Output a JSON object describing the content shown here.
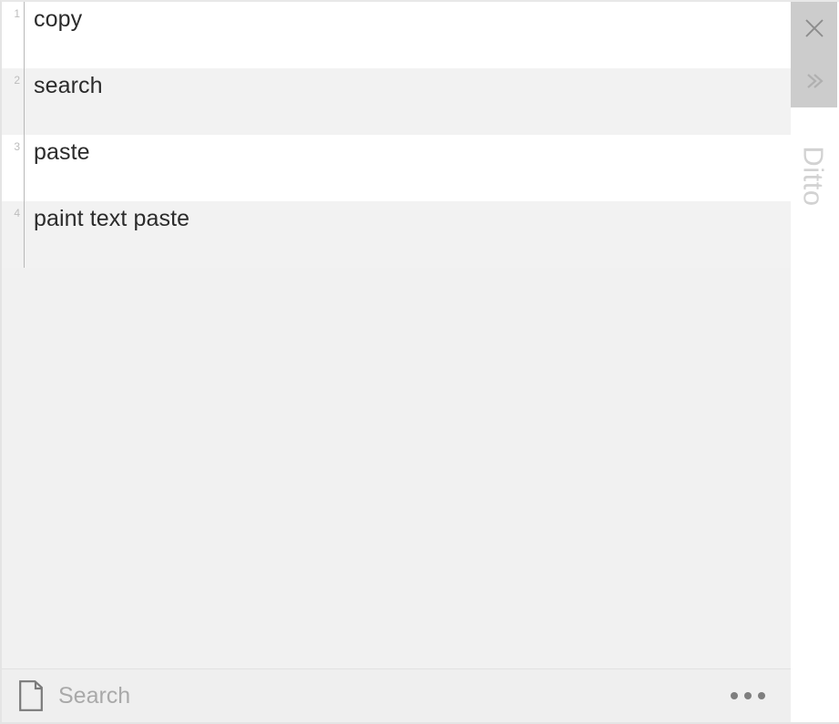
{
  "app": {
    "name": "Ditto",
    "brand_label": "Ditto",
    "accent_color": "#cccccc",
    "row_alt_color": "#f2f2f2",
    "row_base_color": "#ffffff",
    "text_color": "#2b2b2b",
    "index_color": "#bdbdbd"
  },
  "titlebar": {
    "close_label": "✕",
    "close_icon": "close-icon",
    "expand_label": "»",
    "expand_icon": "double-chevron-right-icon"
  },
  "clips": {
    "items": [
      {
        "index": "1",
        "text": "copy"
      },
      {
        "index": "2",
        "text": "search"
      },
      {
        "index": "3",
        "text": "paste"
      },
      {
        "index": "4",
        "text": "paint text paste"
      }
    ]
  },
  "search": {
    "value": "",
    "placeholder": "Search",
    "icon": "clipboard-icon",
    "more_icon": "more-options-icon",
    "more_label": "•••"
  }
}
